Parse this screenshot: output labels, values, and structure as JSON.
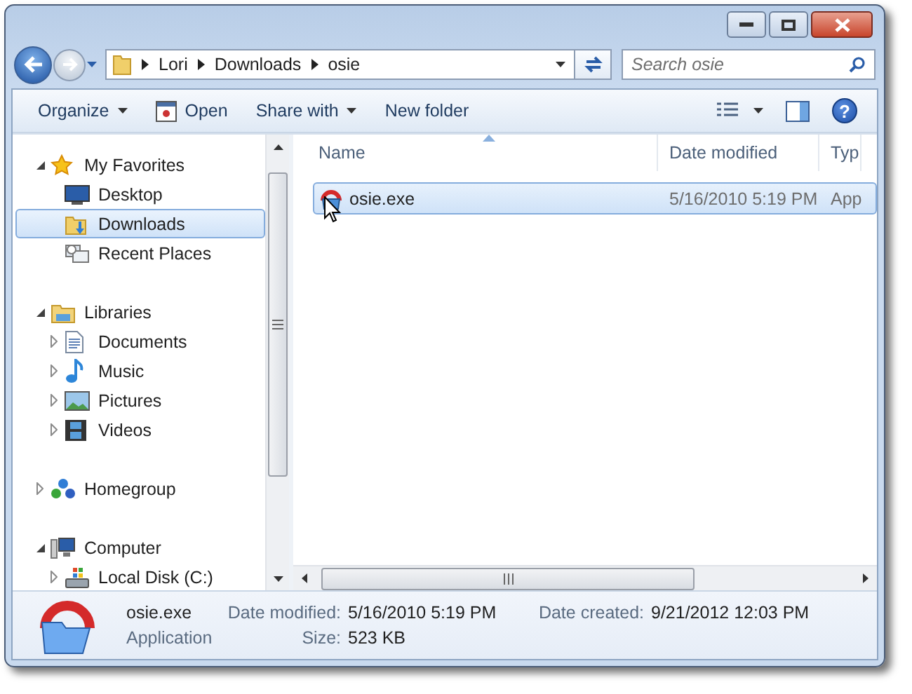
{
  "address": {
    "breadcrumbs": [
      "Lori",
      "Downloads",
      "osie"
    ]
  },
  "search": {
    "placeholder": "Search osie"
  },
  "help": {
    "label": "?"
  },
  "toolbar": [
    {
      "label": "Organize",
      "kind": "menu"
    },
    {
      "label": "Open",
      "kind": "icon-command"
    },
    {
      "label": "Share with",
      "kind": "menu"
    },
    {
      "label": "New folder",
      "kind": "command"
    }
  ],
  "nav": {
    "items": [
      {
        "label": "My Favorites",
        "kind": "star",
        "expanded": true,
        "selected": false,
        "children": [
          {
            "label": "Desktop",
            "kind": "desktop",
            "selected": false
          },
          {
            "label": "Downloads",
            "kind": "downloads",
            "selected": true
          },
          {
            "label": "Recent Places",
            "kind": "recent",
            "selected": false
          }
        ]
      },
      {
        "label": "Libraries",
        "kind": "library",
        "expanded": true,
        "selected": false,
        "children": [
          {
            "label": "Documents",
            "kind": "documents",
            "expanded": false,
            "selected": false
          },
          {
            "label": "Music",
            "kind": "music",
            "expanded": false,
            "selected": false
          },
          {
            "label": "Pictures",
            "kind": "pictures",
            "expanded": false,
            "selected": false
          },
          {
            "label": "Videos",
            "kind": "videos",
            "expanded": false,
            "selected": false
          }
        ]
      },
      {
        "label": "Homegroup",
        "kind": "homegroup",
        "expanded": false,
        "selected": false
      },
      {
        "label": "Computer",
        "kind": "computer",
        "expanded": true,
        "selected": false,
        "children": [
          {
            "label": "Local Disk (C:)",
            "kind": "disk",
            "expanded": false,
            "selected": false
          }
        ]
      }
    ]
  },
  "files": {
    "columns": [
      {
        "label": "Name",
        "sorted": true
      },
      {
        "label": "Date modified",
        "sorted": false
      },
      {
        "label": "Typ",
        "sorted": false
      }
    ],
    "rows": [
      {
        "name": "osie.exe",
        "date": "5/16/2010 5:19 PM",
        "type": "App",
        "selected": true
      }
    ]
  },
  "details": {
    "name": "osie.exe",
    "type": "Application",
    "fields": [
      {
        "label": "Date modified:",
        "value": "5/16/2010 5:19 PM"
      },
      {
        "label": "Date created:",
        "value": "9/21/2012 12:03 PM"
      },
      {
        "label": "Size:",
        "value": "523 KB"
      }
    ]
  }
}
